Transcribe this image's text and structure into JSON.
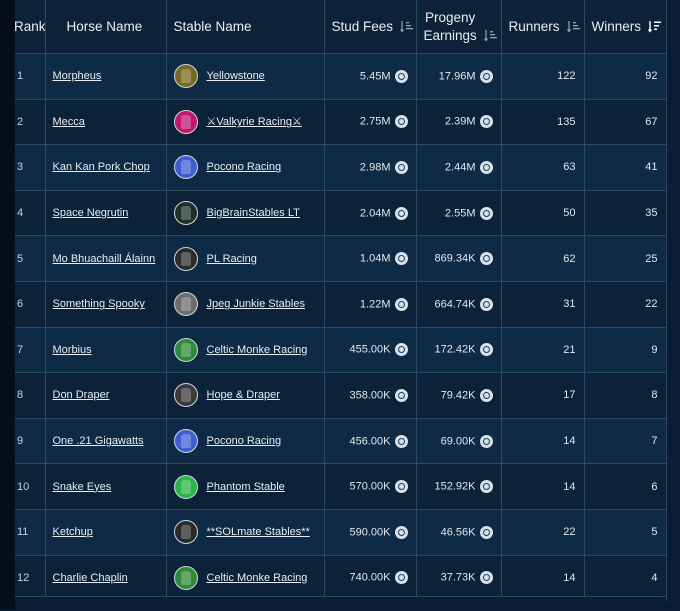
{
  "headers": {
    "rank": "Rank",
    "horse": "Horse Name",
    "stable": "Stable Name",
    "stud": "Stud Fees",
    "progeny_line1": "Progeny",
    "progeny_line2": "Earnings",
    "runners": "Runners",
    "winners": "Winners"
  },
  "rows": [
    {
      "rank": "1",
      "horse": "Morpheus",
      "stable": "Yellowstone",
      "silk": "#7a6a20",
      "stud": "5.45M",
      "progeny": "17.96M",
      "runners": "122",
      "winners": "92"
    },
    {
      "rank": "2",
      "horse": "Mecca",
      "stable": "⚔Valkyrie Racing⚔",
      "silk": "#c2186b",
      "stud": "2.75M",
      "progeny": "2.39M",
      "runners": "135",
      "winners": "67"
    },
    {
      "rank": "3",
      "horse": "Kan Kan Pork Chop",
      "stable": "Pocono Racing",
      "silk": "#3f5fd0",
      "stud": "2.98M",
      "progeny": "2.44M",
      "runners": "63",
      "winners": "41"
    },
    {
      "rank": "4",
      "horse": "Space Negrutin",
      "stable": "BigBrainStables LT",
      "silk": "#1e2f2a",
      "stud": "2.04M",
      "progeny": "2.55M",
      "runners": "50",
      "winners": "35"
    },
    {
      "rank": "5",
      "horse": "Mo Bhuachaill Álainn",
      "stable": "PL Racing",
      "silk": "#2b2b2b",
      "stud": "1.04M",
      "progeny": "869.34K",
      "runners": "62",
      "winners": "25"
    },
    {
      "rank": "6",
      "horse": "Something Spooky",
      "stable": "Jpeg Junkie Stables",
      "silk": "#6d6d6d",
      "stud": "1.22M",
      "progeny": "664.74K",
      "runners": "31",
      "winners": "22"
    },
    {
      "rank": "7",
      "horse": "Morbius",
      "stable": "Celtic Monke Racing",
      "silk": "#2f8a3a",
      "stud": "455.00K",
      "progeny": "172.42K",
      "runners": "21",
      "winners": "9"
    },
    {
      "rank": "8",
      "horse": "Don Draper",
      "stable": "Hope & Draper",
      "silk": "#3a3a3a",
      "stud": "358.00K",
      "progeny": "79.42K",
      "runners": "17",
      "winners": "8"
    },
    {
      "rank": "9",
      "horse": "One .21 Gigawatts",
      "stable": "Pocono Racing",
      "silk": "#3f5fd0",
      "stud": "456.00K",
      "progeny": "69.00K",
      "runners": "14",
      "winners": "7"
    },
    {
      "rank": "10",
      "horse": "Snake Eyes",
      "stable": "Phantom Stable",
      "silk": "#29b34a",
      "stud": "570.00K",
      "progeny": "152.92K",
      "runners": "14",
      "winners": "6"
    },
    {
      "rank": "11",
      "horse": "Ketchup",
      "stable": "**SOLmate Stables**",
      "silk": "#2a2a2a",
      "stud": "590.00K",
      "progeny": "46.56K",
      "runners": "22",
      "winners": "5"
    },
    {
      "rank": "12",
      "horse": "Charlie Chaplin",
      "stable": "Celtic Monke Racing",
      "silk": "#2f8a3a",
      "stud": "740.00K",
      "progeny": "37.73K",
      "runners": "14",
      "winners": "4"
    }
  ]
}
